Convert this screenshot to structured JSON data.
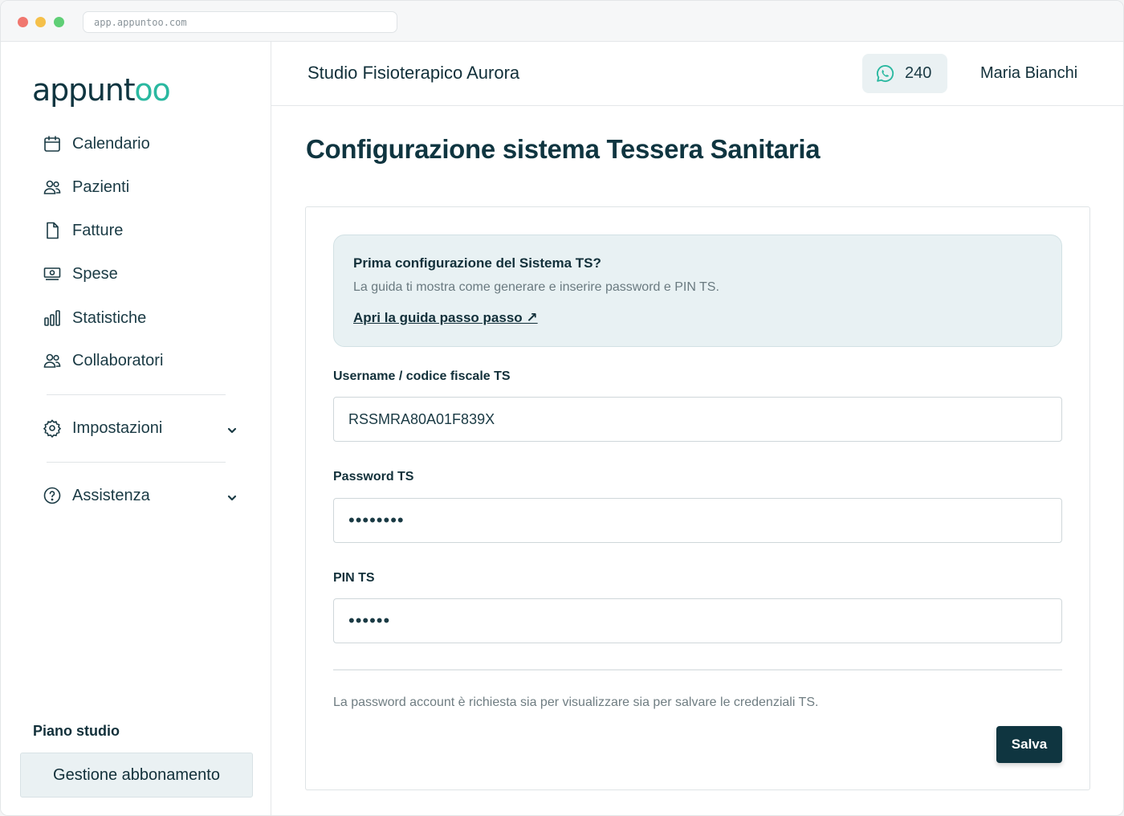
{
  "browser": {
    "url": "app.appuntoo.com"
  },
  "brand": {
    "logo_main": "appunt",
    "logo_accent": "oo",
    "colors": {
      "primary": "#0f3540",
      "accent": "#2ab8a0",
      "info_bg": "#e8f1f3"
    }
  },
  "sidebar": {
    "items": [
      {
        "label": "Calendario",
        "icon": "calendar-icon"
      },
      {
        "label": "Pazienti",
        "icon": "users-icon"
      },
      {
        "label": "Fatture",
        "icon": "document-icon"
      },
      {
        "label": "Spese",
        "icon": "cash-icon"
      },
      {
        "label": "Statistiche",
        "icon": "bar-chart-icon"
      },
      {
        "label": "Collaboratori",
        "icon": "users-icon"
      }
    ],
    "settings_label": "Impostazioni",
    "help_label": "Assistenza",
    "plan_label": "Piano studio",
    "plan_button": "Gestione abbonamento"
  },
  "header": {
    "studio_name": "Studio Fisioterapico Aurora",
    "whatsapp_count": "240",
    "user_name": "Maria Bianchi"
  },
  "main": {
    "title": "Configurazione sistema Tessera Sanitaria",
    "info": {
      "title": "Prima configurazione del Sistema TS?",
      "text": "La guida ti mostra come generare e inserire password e PIN TS.",
      "link": "Apri la guida passo passo ↗"
    },
    "form": {
      "username_label": "Username / codice fiscale TS",
      "username_value": "RSSMRA80A01F839X",
      "password_label": "Password TS",
      "password_value": "••••••••",
      "pin_label": "PIN TS",
      "pin_value": "••••••",
      "note": "La password account è richiesta sia per visualizzare sia per salvare le credenziali TS.",
      "save_label": "Salva"
    }
  }
}
